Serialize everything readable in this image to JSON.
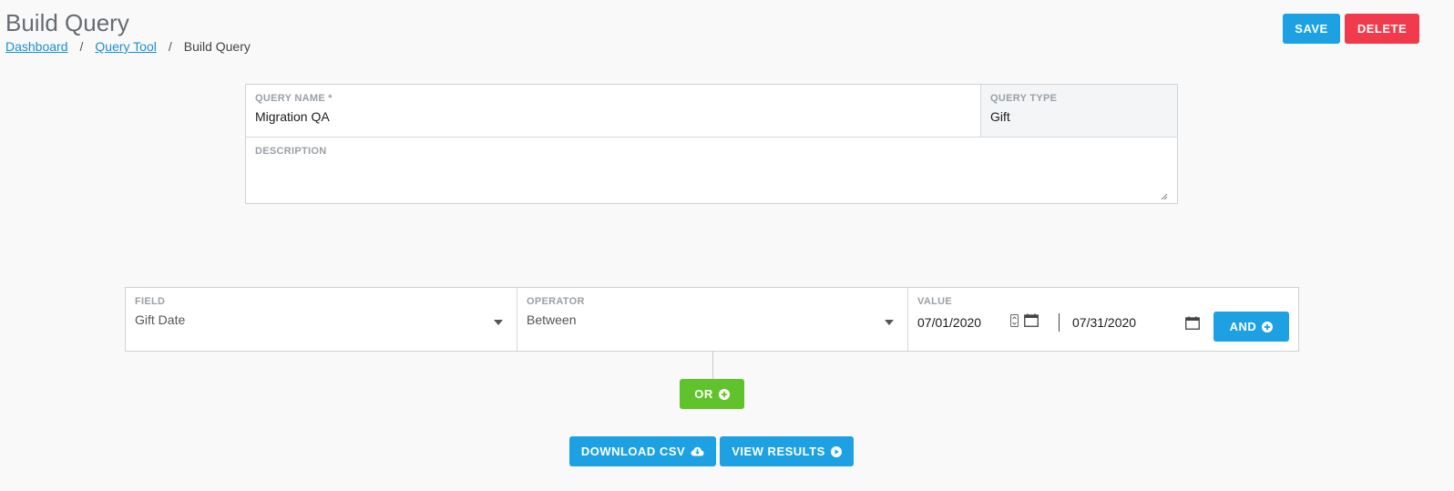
{
  "page": {
    "title": "Build Query"
  },
  "breadcrumb": {
    "items": [
      "Dashboard",
      "Query Tool",
      "Build Query"
    ],
    "separator": "/"
  },
  "header": {
    "save_label": "SAVE",
    "delete_label": "DELETE"
  },
  "query": {
    "name_label": "QUERY NAME *",
    "name_value": "Migration QA",
    "type_label": "QUERY TYPE",
    "type_value": "Gift",
    "description_label": "DESCRIPTION",
    "description_value": ""
  },
  "filter": {
    "field_label": "FIELD",
    "field_value": "Gift Date",
    "operator_label": "OPERATOR",
    "operator_value": "Between",
    "value_label": "VALUE",
    "value_from": "07/01/2020",
    "value_to": "07/31/2020",
    "and_label": "AND"
  },
  "actions": {
    "or_label": "OR",
    "download_label": "DOWNLOAD CSV",
    "results_label": "VIEW RESULTS"
  },
  "colors": {
    "primary": "#1da1e2",
    "danger": "#f23a4d",
    "success": "#61c32b",
    "link": "#1a8fd6"
  },
  "icons": {
    "and": "plus-circle-icon",
    "or": "plus-circle-icon",
    "download": "cloud-download-icon",
    "results": "play-circle-icon",
    "date": "calendar-icon",
    "spinner": "date-spinner-icon",
    "dropdown": "chevron-down-icon"
  }
}
